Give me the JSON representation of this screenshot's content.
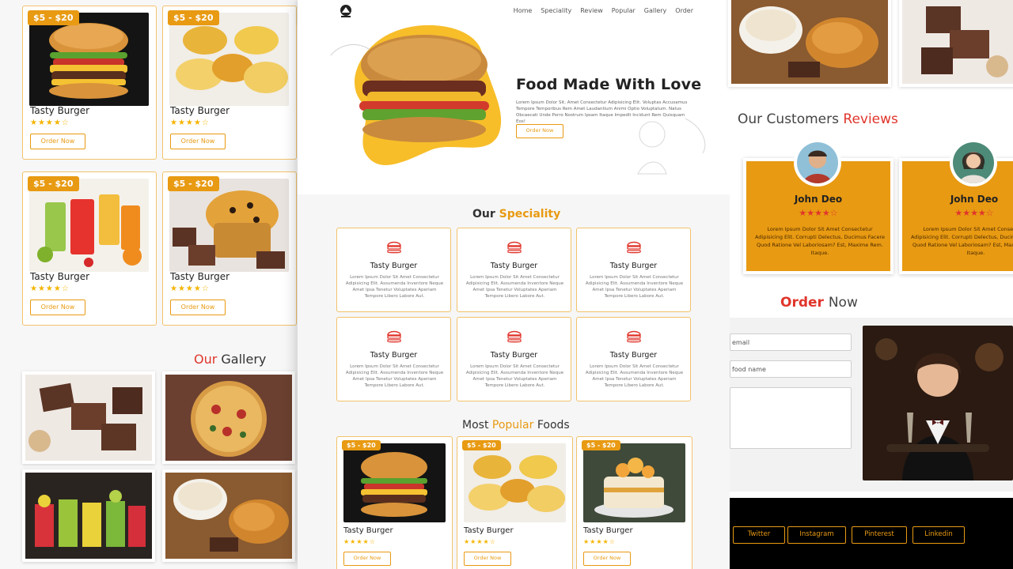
{
  "left": {
    "cards": [
      {
        "price": "$5 - $20",
        "title": "Tasty Burger",
        "rating": 4,
        "button": "Order Now"
      },
      {
        "price": "$5 - $20",
        "title": "Tasty Burger",
        "rating": 4,
        "button": "Order Now"
      },
      {
        "price": "$5 - $20",
        "title": "Tasty Burger",
        "rating": 4,
        "button": "Order Now"
      },
      {
        "price": "$5 - $20",
        "title": "Tasty Burger",
        "rating": 4,
        "button": "Order Now"
      }
    ],
    "gallery_title_accent": "Our",
    "gallery_title_rest": "Gallery"
  },
  "nav": {
    "links": [
      "Home",
      "Speciality",
      "Review",
      "Popular",
      "Gallery",
      "Order"
    ]
  },
  "hero": {
    "heading": "Food Made With Love",
    "text": "Lorem Ipsum Dolor Sit, Amet Consectetur Adipisicing Elit. Voluptas Accusamus Tempore Temporibus Rem Amet Laudantium Animi Optio Voluptatum. Natus Obcaecati Unde Porro Nostrum Ipsam Itaque Impedit Incidunt Rem Quisquam Eos!",
    "button": "Order Now"
  },
  "speciality": {
    "title_plain": "Our",
    "title_accent": "Speciality",
    "items": [
      {
        "title": "Tasty Burger",
        "text": "Lorem Ipsum Dolor Sit Amet Consectetur Adipisicing Elit. Assumenda Inventore Neque Amet Ipsa Tenetur Voluptates Aperiam Tempore Libero Labore Aut."
      },
      {
        "title": "Tasty Burger",
        "text": "Lorem Ipsum Dolor Sit Amet Consectetur Adipisicing Elit. Assumenda Inventore Neque Amet Ipsa Tenetur Voluptates Aperiam Tempore Libero Labore Aut."
      },
      {
        "title": "Tasty Burger",
        "text": "Lorem Ipsum Dolor Sit Amet Consectetur Adipisicing Elit. Assumenda Inventore Neque Amet Ipsa Tenetur Voluptates Aperiam Tempore Libero Labore Aut."
      },
      {
        "title": "Tasty Burger",
        "text": "Lorem Ipsum Dolor Sit Amet Consectetur Adipisicing Elit. Assumenda Inventore Neque Amet Ipsa Tenetur Voluptates Aperiam Tempore Libero Labore Aut."
      },
      {
        "title": "Tasty Burger",
        "text": "Lorem Ipsum Dolor Sit Amet Consectetur Adipisicing Elit. Assumenda Inventore Neque Amet Ipsa Tenetur Voluptates Aperiam Tempore Libero Labore Aut."
      },
      {
        "title": "Tasty Burger",
        "text": "Lorem Ipsum Dolor Sit Amet Consectetur Adipisicing Elit. Assumenda Inventore Neque Amet Ipsa Tenetur Voluptates Aperiam Tempore Libero Labore Aut."
      }
    ]
  },
  "popular": {
    "title_plain_1": "Most",
    "title_accent": "Popular",
    "title_plain_2": "Foods",
    "cards": [
      {
        "price": "$5 - $20",
        "title": "Tasty Burger",
        "rating": 4,
        "button": "Order Now"
      },
      {
        "price": "$5 - $20",
        "title": "Tasty Burger",
        "rating": 4,
        "button": "Order Now"
      },
      {
        "price": "$5 - $20",
        "title": "Tasty Burger",
        "rating": 4,
        "button": "Order Now"
      }
    ]
  },
  "reviews": {
    "title_plain": "Our Customers",
    "title_accent": "Reviews",
    "items": [
      {
        "name": "John Deo",
        "rating": 4,
        "text": "Lorem Ipsum Dolor Sit Amet Consectetur Adipisicing Elit. Corrupti Delectus, Ducimus Facere Quod Ratione Vel Laboriosam? Est, Maxime Rem. Itaque."
      },
      {
        "name": "John Deo",
        "rating": 4,
        "text": "Lorem Ipsum Dolor Sit Amet Consectetur Adipisicing Elit. Corrupti Delectus, Ducimus Facere Quod Ratione Vel Laboriosam? Est, Maxime Rem. Itaque."
      }
    ]
  },
  "order": {
    "title_accent": "Order",
    "title_plain": "Now",
    "email_placeholder": "email",
    "food_placeholder": "food name"
  },
  "footer": {
    "social": [
      "Twitter",
      "Instagram",
      "Pinterest",
      "Linkedin"
    ]
  },
  "colors": {
    "accent": "#e89a12",
    "red": "#e0352b",
    "star": "#f5b400"
  }
}
